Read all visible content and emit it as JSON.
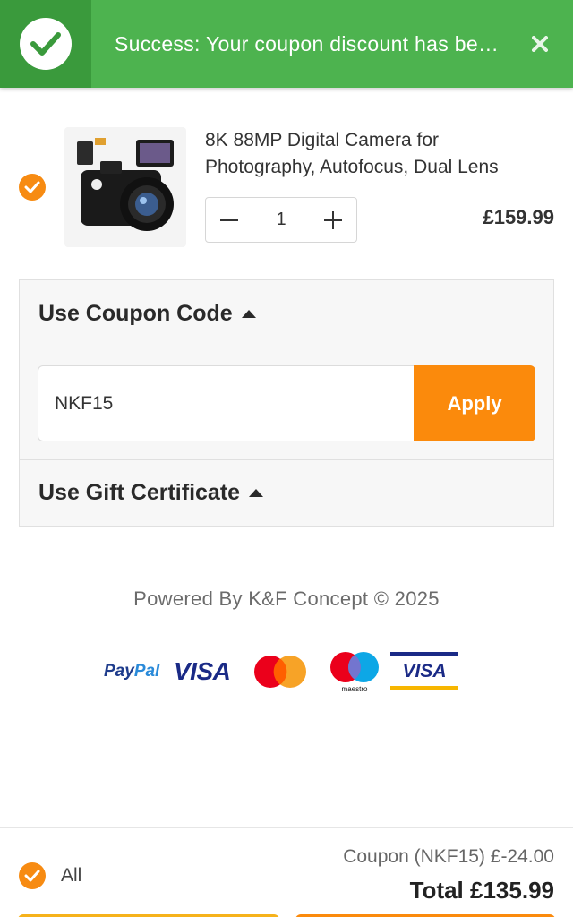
{
  "toast": {
    "message": "Success: Your coupon discount has been applied!",
    "icon": "check-icon",
    "close_icon": "close-icon",
    "color": "#4db34f"
  },
  "cart_item": {
    "selected": true,
    "title_line1": "8K 88MP Digital Camera for",
    "title_line2": "Photography, Autofocus, Dual Lens",
    "quantity": "1",
    "price": "£159.99",
    "image": "camera-product-image"
  },
  "coupon": {
    "heading": "Use Coupon Code",
    "input_value": "NKF15",
    "apply_label": "Apply"
  },
  "gift": {
    "heading": "Use Gift Certificate"
  },
  "footer": {
    "powered_by": "Powered By K&F Concept © 2025",
    "payment_methods": {
      "paypal_a": "Pay",
      "paypal_b": "Pal",
      "visa": "VISA",
      "maestro": "maestro",
      "visa_electron": "VISA"
    }
  },
  "summary": {
    "all_label": "All",
    "coupon_line": "Coupon (NKF15)  £-24.00",
    "total_line": "Total £135.99"
  },
  "colors": {
    "accent": "#fb8a0c",
    "success": "#4db34f"
  }
}
